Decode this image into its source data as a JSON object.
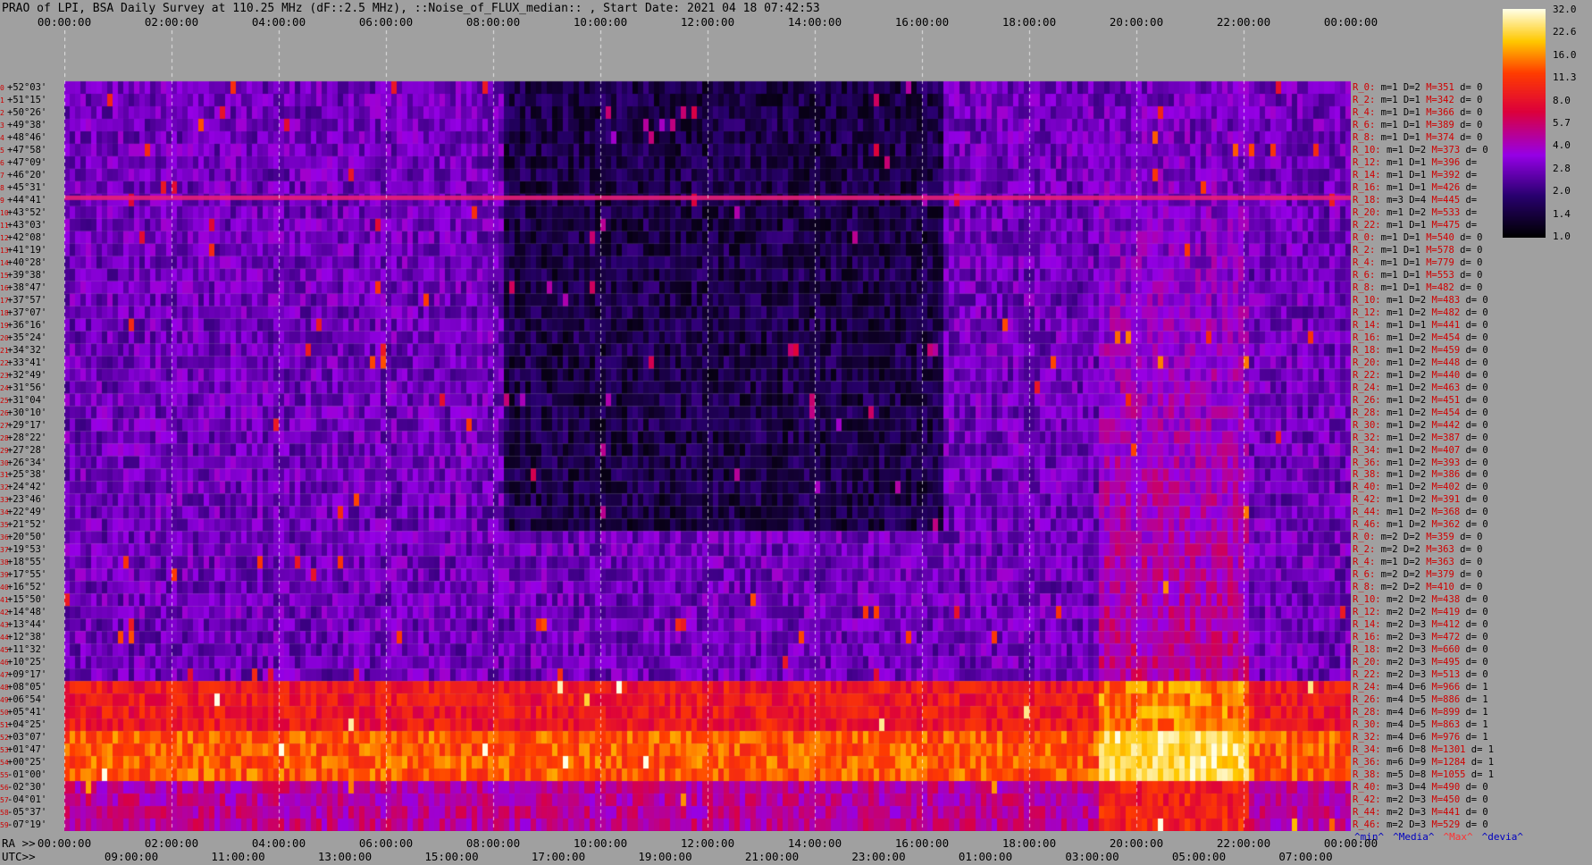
{
  "title": "PRAO of LPI, BSA Daily Survey at 110.25 MHz (dF::2.5 MHz), ::Noise_of_FLUX_median:: , Start Date: 2021 04 18 07:42:53",
  "axis_labels": {
    "ra": "RA >>",
    "utc": "UTC>>"
  },
  "legend": {
    "min": "^min^",
    "median": "^Media^",
    "max": "^Max^",
    "devia": "^devia^"
  },
  "colors": {
    "background": "#a0a0a0",
    "accent_red": "#d00000",
    "legend_max": "#ff3030",
    "legend_blue": "#0000c0"
  },
  "chart_data": {
    "type": "heatmap",
    "top_ticks": [
      "00:00:00",
      "02:00:00",
      "04:00:00",
      "06:00:00",
      "08:00:00",
      "10:00:00",
      "12:00:00",
      "14:00:00",
      "16:00:00",
      "18:00:00",
      "20:00:00",
      "22:00:00",
      "00:00:00"
    ],
    "ra_ticks": [
      "00:00:00",
      "02:00:00",
      "04:00:00",
      "06:00:00",
      "08:00:00",
      "10:00:00",
      "12:00:00",
      "14:00:00",
      "16:00:00",
      "18:00:00",
      "20:00:00",
      "22:00:00",
      "00:00:00"
    ],
    "utc_ticks": [
      "09:00:00",
      "11:00:00",
      "13:00:00",
      "15:00:00",
      "17:00:00",
      "19:00:00",
      "21:00:00",
      "23:00:00",
      "01:00:00",
      "03:00:00",
      "05:00:00",
      "07:00:00"
    ],
    "colorbar": {
      "ticks": [
        "32.0",
        "22.6",
        "16.0",
        "11.3",
        "8.0",
        "5.7",
        "4.0",
        "2.8",
        "2.0",
        "1.4",
        "1.0"
      ],
      "min": 1.0,
      "max": 32.0,
      "scale": "log"
    },
    "rows": [
      {
        "i": "0",
        "dec": "+52°03'",
        "r": "R_0:",
        "m": "m=1",
        "D": "D=2",
        "M": "M=351",
        "d": "d= 0"
      },
      {
        "i": "1",
        "dec": "+51°15'",
        "r": "R_2:",
        "m": "m=1",
        "D": "D=1",
        "M": "M=342",
        "d": "d= 0"
      },
      {
        "i": "2",
        "dec": "+50°26'",
        "r": "R_4:",
        "m": "m=1",
        "D": "D=1",
        "M": "M=366",
        "d": "d= 0"
      },
      {
        "i": "3",
        "dec": "+49°38'",
        "r": "R_6:",
        "m": "m=1",
        "D": "D=1",
        "M": "M=389",
        "d": "d= 0"
      },
      {
        "i": "4",
        "dec": "+48°46'",
        "r": "R_8:",
        "m": "m=1",
        "D": "D=1",
        "M": "M=374",
        "d": "d= 0"
      },
      {
        "i": "5",
        "dec": "+47°58'",
        "r": "R_10:",
        "m": "m=1",
        "D": "D=2",
        "M": "M=373",
        "d": "d= 0"
      },
      {
        "i": "6",
        "dec": "+47°09'",
        "r": "R_12:",
        "m": "m=1",
        "D": "D=1",
        "M": "M=396",
        "d": "d="
      },
      {
        "i": "7",
        "dec": "+46°20'",
        "r": "R_14:",
        "m": "m=1",
        "D": "D=1",
        "M": "M=392",
        "d": "d="
      },
      {
        "i": "8",
        "dec": "+45°31'",
        "r": "R_16:",
        "m": "m=1",
        "D": "D=1",
        "M": "M=426",
        "d": "d="
      },
      {
        "i": "9",
        "dec": "+44°41'",
        "r": "R_18:",
        "m": "m=3",
        "D": "D=4",
        "M": "M=445",
        "d": "d="
      },
      {
        "i": "10",
        "dec": "+43°52'",
        "r": "R_20:",
        "m": "m=1",
        "D": "D=2",
        "M": "M=533",
        "d": "d="
      },
      {
        "i": "11",
        "dec": "+43°03'",
        "r": "R_22:",
        "m": "m=1",
        "D": "D=1",
        "M": "M=475",
        "d": "d="
      },
      {
        "i": "12",
        "dec": "+42°08'",
        "r": "R_0:",
        "m": "m=1",
        "D": "D=1",
        "M": "M=540",
        "d": "d= 0"
      },
      {
        "i": "13",
        "dec": "+41°19'",
        "r": "R_2:",
        "m": "m=1",
        "D": "D=1",
        "M": "M=578",
        "d": "d= 0"
      },
      {
        "i": "14",
        "dec": "+40°28'",
        "r": "R_4:",
        "m": "m=1",
        "D": "D=1",
        "M": "M=779",
        "d": "d= 0"
      },
      {
        "i": "15",
        "dec": "+39°38'",
        "r": "R_6:",
        "m": "m=1",
        "D": "D=1",
        "M": "M=553",
        "d": "d= 0"
      },
      {
        "i": "16",
        "dec": "+38°47'",
        "r": "R_8:",
        "m": "m=1",
        "D": "D=1",
        "M": "M=482",
        "d": "d= 0"
      },
      {
        "i": "17",
        "dec": "+37°57'",
        "r": "R_10:",
        "m": "m=1",
        "D": "D=2",
        "M": "M=483",
        "d": "d= 0"
      },
      {
        "i": "18",
        "dec": "+37°07'",
        "r": "R_12:",
        "m": "m=1",
        "D": "D=2",
        "M": "M=482",
        "d": "d= 0"
      },
      {
        "i": "19",
        "dec": "+36°16'",
        "r": "R_14:",
        "m": "m=1",
        "D": "D=1",
        "M": "M=441",
        "d": "d= 0"
      },
      {
        "i": "20",
        "dec": "+35°24'",
        "r": "R_16:",
        "m": "m=1",
        "D": "D=2",
        "M": "M=454",
        "d": "d= 0"
      },
      {
        "i": "21",
        "dec": "+34°32'",
        "r": "R_18:",
        "m": "m=1",
        "D": "D=2",
        "M": "M=459",
        "d": "d= 0"
      },
      {
        "i": "22",
        "dec": "+33°41'",
        "r": "R_20:",
        "m": "m=1",
        "D": "D=2",
        "M": "M=448",
        "d": "d= 0"
      },
      {
        "i": "23",
        "dec": "+32°49'",
        "r": "R_22:",
        "m": "m=1",
        "D": "D=2",
        "M": "M=440",
        "d": "d= 0"
      },
      {
        "i": "24",
        "dec": "+31°56'",
        "r": "R_24:",
        "m": "m=1",
        "D": "D=2",
        "M": "M=463",
        "d": "d= 0"
      },
      {
        "i": "25",
        "dec": "+31°04'",
        "r": "R_26:",
        "m": "m=1",
        "D": "D=2",
        "M": "M=451",
        "d": "d= 0"
      },
      {
        "i": "26",
        "dec": "+30°10'",
        "r": "R_28:",
        "m": "m=1",
        "D": "D=2",
        "M": "M=454",
        "d": "d= 0"
      },
      {
        "i": "27",
        "dec": "+29°17'",
        "r": "R_30:",
        "m": "m=1",
        "D": "D=2",
        "M": "M=442",
        "d": "d= 0"
      },
      {
        "i": "28",
        "dec": "+28°22'",
        "r": "R_32:",
        "m": "m=1",
        "D": "D=2",
        "M": "M=387",
        "d": "d= 0"
      },
      {
        "i": "29",
        "dec": "+27°28'",
        "r": "R_34:",
        "m": "m=1",
        "D": "D=2",
        "M": "M=407",
        "d": "d= 0"
      },
      {
        "i": "30",
        "dec": "+26°34'",
        "r": "R_36:",
        "m": "m=1",
        "D": "D=2",
        "M": "M=393",
        "d": "d= 0"
      },
      {
        "i": "31",
        "dec": "+25°38'",
        "r": "R_38:",
        "m": "m=1",
        "D": "D=2",
        "M": "M=386",
        "d": "d= 0"
      },
      {
        "i": "32",
        "dec": "+24°42'",
        "r": "R_40:",
        "m": "m=1",
        "D": "D=2",
        "M": "M=402",
        "d": "d= 0"
      },
      {
        "i": "33",
        "dec": "+23°46'",
        "r": "R_42:",
        "m": "m=1",
        "D": "D=2",
        "M": "M=391",
        "d": "d= 0"
      },
      {
        "i": "34",
        "dec": "+22°49'",
        "r": "R_44:",
        "m": "m=1",
        "D": "D=2",
        "M": "M=368",
        "d": "d= 0"
      },
      {
        "i": "35",
        "dec": "+21°52'",
        "r": "R_46:",
        "m": "m=1",
        "D": "D=2",
        "M": "M=362",
        "d": "d= 0"
      },
      {
        "i": "36",
        "dec": "+20°50'",
        "r": "R_0:",
        "m": "m=2",
        "D": "D=2",
        "M": "M=359",
        "d": "d= 0"
      },
      {
        "i": "37",
        "dec": "+19°53'",
        "r": "R_2:",
        "m": "m=2",
        "D": "D=2",
        "M": "M=363",
        "d": "d= 0"
      },
      {
        "i": "38",
        "dec": "+18°55'",
        "r": "R_4:",
        "m": "m=1",
        "D": "D=2",
        "M": "M=363",
        "d": "d= 0"
      },
      {
        "i": "39",
        "dec": "+17°55'",
        "r": "R_6:",
        "m": "m=2",
        "D": "D=2",
        "M": "M=379",
        "d": "d= 0"
      },
      {
        "i": "40",
        "dec": "+16°52'",
        "r": "R_8:",
        "m": "m=2",
        "D": "D=2",
        "M": "M=410",
        "d": "d= 0"
      },
      {
        "i": "41",
        "dec": "+15°50'",
        "r": "R_10:",
        "m": "m=2",
        "D": "D=2",
        "M": "M=438",
        "d": "d= 0"
      },
      {
        "i": "42",
        "dec": "+14°48'",
        "r": "R_12:",
        "m": "m=2",
        "D": "D=2",
        "M": "M=419",
        "d": "d= 0"
      },
      {
        "i": "43",
        "dec": "+13°44'",
        "r": "R_14:",
        "m": "m=2",
        "D": "D=3",
        "M": "M=412",
        "d": "d= 0"
      },
      {
        "i": "44",
        "dec": "+12°38'",
        "r": "R_16:",
        "m": "m=2",
        "D": "D=3",
        "M": "M=472",
        "d": "d= 0"
      },
      {
        "i": "45",
        "dec": "+11°32'",
        "r": "R_18:",
        "m": "m=2",
        "D": "D=3",
        "M": "M=660",
        "d": "d= 0"
      },
      {
        "i": "46",
        "dec": "+10°25'",
        "r": "R_20:",
        "m": "m=2",
        "D": "D=3",
        "M": "M=495",
        "d": "d= 0"
      },
      {
        "i": "47",
        "dec": "+09°17'",
        "r": "R_22:",
        "m": "m=2",
        "D": "D=3",
        "M": "M=513",
        "d": "d= 0"
      },
      {
        "i": "48",
        "dec": "+08°05'",
        "r": "R_24:",
        "m": "m=4",
        "D": "D=6",
        "M": "M=966",
        "d": "d= 1"
      },
      {
        "i": "49",
        "dec": "+06°54'",
        "r": "R_26:",
        "m": "m=4",
        "D": "D=5",
        "M": "M=886",
        "d": "d= 1"
      },
      {
        "i": "50",
        "dec": "+05°41'",
        "r": "R_28:",
        "m": "m=4",
        "D": "D=6",
        "M": "M=899",
        "d": "d= 1"
      },
      {
        "i": "51",
        "dec": "+04°25'",
        "r": "R_30:",
        "m": "m=4",
        "D": "D=5",
        "M": "M=863",
        "d": "d= 1"
      },
      {
        "i": "52",
        "dec": "+03°07'",
        "r": "R_32:",
        "m": "m=4",
        "D": "D=6",
        "M": "M=976",
        "d": "d= 1"
      },
      {
        "i": "53",
        "dec": "+01°47'",
        "r": "R_34:",
        "m": "m=6",
        "D": "D=8",
        "M": "M=1301",
        "d": "d= 1"
      },
      {
        "i": "54",
        "dec": "+00°25'",
        "r": "R_36:",
        "m": "m=6",
        "D": "D=9",
        "M": "M=1284",
        "d": "d= 1"
      },
      {
        "i": "55",
        "dec": "-01°00'",
        "r": "R_38:",
        "m": "m=5",
        "D": "D=8",
        "M": "M=1055",
        "d": "d= 1"
      },
      {
        "i": "56",
        "dec": "-02°30'",
        "r": "R_40:",
        "m": "m=3",
        "D": "D=4",
        "M": "M=490",
        "d": "d= 0"
      },
      {
        "i": "57",
        "dec": "-04°01'",
        "r": "R_42:",
        "m": "m=2",
        "D": "D=3",
        "M": "M=450",
        "d": "d= 0"
      },
      {
        "i": "58",
        "dec": "-05°37'",
        "r": "R_44:",
        "m": "m=2",
        "D": "D=3",
        "M": "M=441",
        "d": "d= 0"
      },
      {
        "i": "59",
        "dec": "-07°19'",
        "r": "R_46:",
        "m": "m=2",
        "D": "D=3",
        "M": "M=529",
        "d": "d= 0"
      }
    ]
  }
}
